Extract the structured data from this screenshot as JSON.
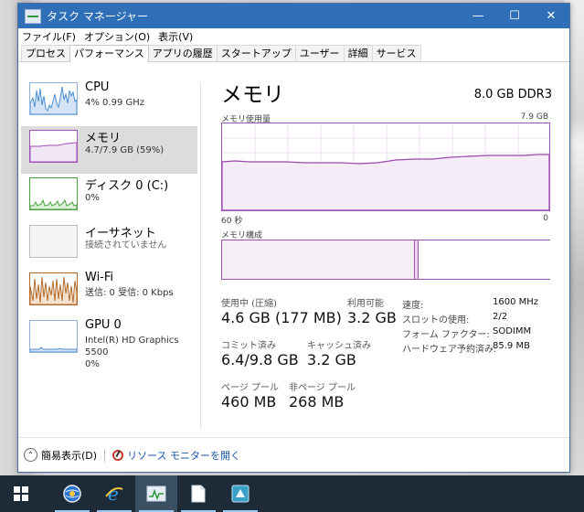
{
  "window": {
    "title": "タスク マネージャー",
    "minimize": "—",
    "maximize": "☐",
    "close": "✕"
  },
  "menu": [
    "ファイル(F)",
    "オプション(O)",
    "表示(V)"
  ],
  "tabs": [
    "プロセス",
    "パフォーマンス",
    "アプリの履歴",
    "スタートアップ",
    "ユーザー",
    "詳細",
    "サービス"
  ],
  "active_tab_index": 1,
  "sidebar": [
    {
      "name": "CPU",
      "detail1": "4% 0.99 GHz",
      "detail2": ""
    },
    {
      "name": "メモリ",
      "detail1": "4.7/7.9 GB (59%)",
      "detail2": ""
    },
    {
      "name": "ディスク 0 (C:)",
      "detail1": "0%",
      "detail2": ""
    },
    {
      "name": "イーサネット",
      "detail1": "接続されていません",
      "detail2": ""
    },
    {
      "name": "Wi-Fi",
      "detail1": "送信: 0 受信: 0 Kbps",
      "detail2": ""
    },
    {
      "name": "GPU 0",
      "detail1": "Intel(R) HD Graphics 5500",
      "detail2": "0%"
    }
  ],
  "main": {
    "title": "メモリ",
    "spec": "8.0 GB DDR3",
    "usage_label": "メモリ使用量",
    "usage_max": "7.9 GB",
    "time_left": "60 秒",
    "time_right": "0",
    "composition_label": "メモリ構成",
    "stats": {
      "in_use_label": "使用中 (圧縮)",
      "in_use_value": "4.6 GB (177 MB)",
      "available_label": "利用可能",
      "available_value": "3.2 GB",
      "committed_label": "コミット済み",
      "committed_value": "6.4/9.8 GB",
      "cached_label": "キャッシュ済み",
      "cached_value": "3.2 GB",
      "paged_label": "ページ プール",
      "paged_value": "460 MB",
      "nonpaged_label": "非ページ プール",
      "nonpaged_value": "268 MB"
    },
    "details": [
      {
        "k": "速度:",
        "v": "1600 MHz"
      },
      {
        "k": "スロットの使用:",
        "v": "2/2"
      },
      {
        "k": "フォーム ファクター:",
        "v": "SODIMM"
      },
      {
        "k": "ハードウェア予約済み:",
        "v": "85.9 MB"
      }
    ]
  },
  "footer": {
    "fewer_details": "簡易表示(D)",
    "resource_monitor": "リソース モニターを開く"
  },
  "colors": {
    "titlebar": "#2f6fb7",
    "memory_accent": "#a251b8",
    "cpu_accent": "#4c8fd6",
    "disk_accent": "#4aa241",
    "wifi_accent": "#b26a2a",
    "taskbar": "#1d2b38"
  },
  "taskbar_icons": [
    "windows-logo-icon",
    "browser-globe-icon",
    "internet-explorer-icon",
    "task-manager-icon",
    "document-icon",
    "app-icon"
  ]
}
